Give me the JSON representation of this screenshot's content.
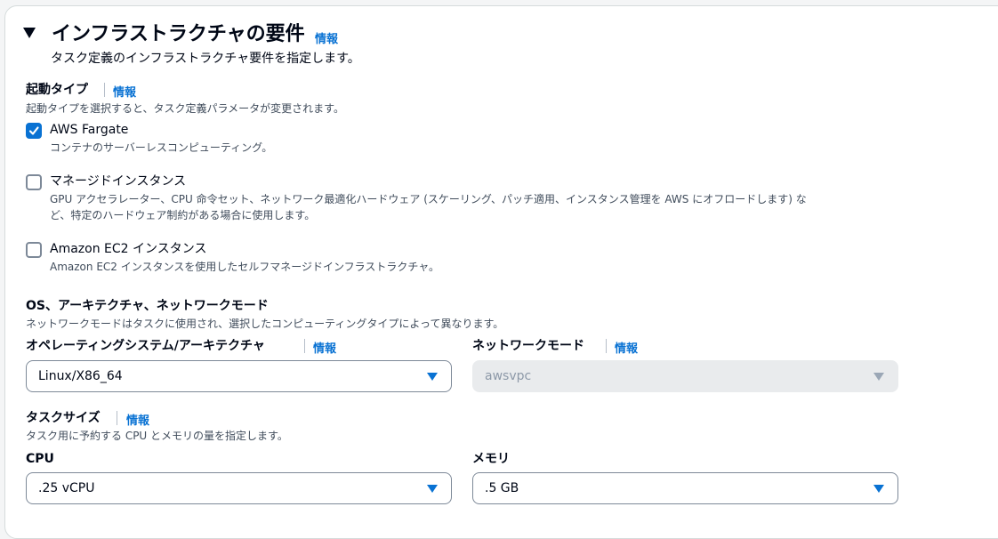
{
  "section": {
    "title": "インフラストラクチャの要件",
    "info": "情報",
    "description": "タスク定義のインフラストラクチャ要件を指定します。"
  },
  "launch_type": {
    "label": "起動タイプ",
    "info": "情報",
    "description": "起動タイプを選択すると、タスク定義パラメータが変更されます。",
    "options": [
      {
        "label": "AWS Fargate",
        "description": "コンテナのサーバーレスコンピューティング。",
        "checked": true
      },
      {
        "label": "マネージドインスタンス",
        "description_line1": "GPU アクセラレーター、CPU 命令セット、ネットワーク最適化ハードウェア (スケーリング、パッチ適用、インスタンス管理を AWS にオフロードします) な",
        "description_line2": "ど、特定のハードウェア制約がある場合に使用します。",
        "checked": false
      },
      {
        "label": "Amazon EC2 インスタンス",
        "description": "Amazon EC2 インスタンスを使用したセルフマネージドインフラストラクチャ。",
        "checked": false
      }
    ]
  },
  "os_arch_network": {
    "label": "OS、アーキテクチャ、ネットワークモード",
    "description": "ネットワークモードはタスクに使用され、選択したコンピューティングタイプによって異なります。",
    "os_arch": {
      "label": "オペレーティングシステム/アーキテクチャ",
      "info": "情報",
      "value": "Linux/X86_64"
    },
    "network_mode": {
      "label": "ネットワークモード",
      "info": "情報",
      "value": "awsvpc"
    }
  },
  "task_size": {
    "label": "タスクサイズ",
    "info": "情報",
    "description": "タスク用に予約する CPU とメモリの量を指定します。",
    "cpu": {
      "label": "CPU",
      "value": ".25 vCPU"
    },
    "memory": {
      "label": "メモリ",
      "value": ".5 GB"
    }
  },
  "colors": {
    "link": "#0972d3",
    "checkbox_checked": "#0972d3",
    "text": "#000716",
    "muted": "#414d5c"
  }
}
